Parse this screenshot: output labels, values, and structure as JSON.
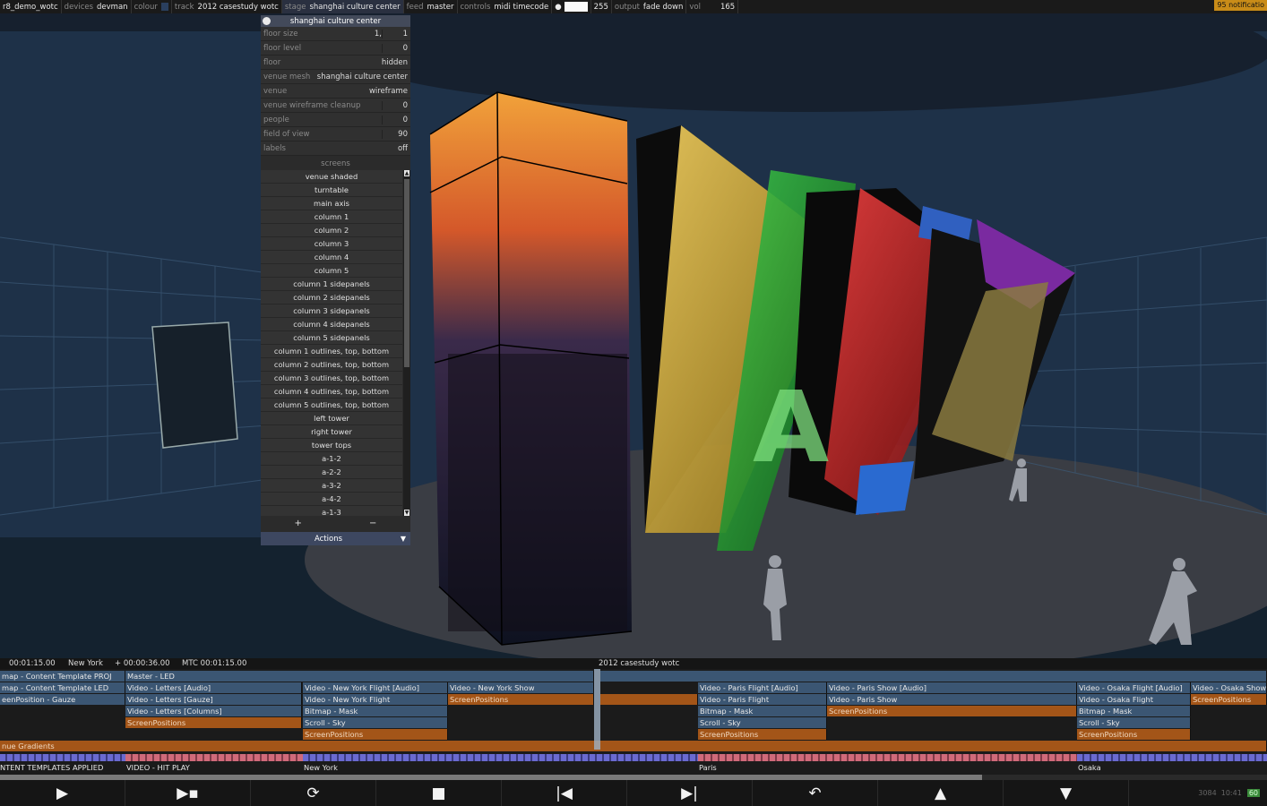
{
  "topbar": {
    "project": "r8_demo_wotc",
    "devices_label": "devices",
    "devices_value": "devman",
    "colour_label": "colour",
    "track_label": "track",
    "track_value": "2012 casestudy wotc",
    "stage_label": "stage",
    "stage_value": "shanghai culture center",
    "feed_label": "feed",
    "feed_value": "master",
    "controls_label": "controls",
    "controls_value": "midi timecode",
    "level_value": "255",
    "output_label": "output",
    "output_value": "fade down",
    "vol_label": "vol",
    "vol_value": "165",
    "notifications": "95 notificatio"
  },
  "panel": {
    "title": "shanghai culture center",
    "props": [
      {
        "label": "floor size",
        "value": "1,",
        "value2": "1"
      },
      {
        "label": "floor level",
        "value": "",
        "value2": "0"
      },
      {
        "label": "floor",
        "value": "hidden",
        "value2": ""
      },
      {
        "label": "venue mesh",
        "value": "shanghai culture center",
        "value2": ""
      },
      {
        "label": "venue",
        "value": "wireframe",
        "value2": ""
      },
      {
        "label": "venue wireframe cleanup",
        "value": "",
        "value2": "0"
      },
      {
        "label": "people",
        "value": "",
        "value2": "0"
      },
      {
        "label": "field of view",
        "value": "",
        "value2": "90"
      },
      {
        "label": "labels",
        "value": "off",
        "value2": ""
      }
    ],
    "screens_header": "screens",
    "screens": [
      "venue shaded",
      "turntable",
      "main axis",
      "column 1",
      "column 2",
      "column 3",
      "column 4",
      "column 5",
      "column 1 sidepanels",
      "column 2 sidepanels",
      "column 3 sidepanels",
      "column 4 sidepanels",
      "column 5 sidepanels",
      "column 1 outlines, top, bottom",
      "column 2 outlines, top, bottom",
      "column 3 outlines, top, bottom",
      "column 4 outlines, top, bottom",
      "column 5 outlines, top, bottom",
      "left tower",
      "right tower",
      "tower tops",
      "a-1-2",
      "a-2-2",
      "a-3-2",
      "a-4-2",
      "a-1-3"
    ],
    "plus": "+",
    "minus": "−",
    "actions": "Actions",
    "actions_arrow": "▼"
  },
  "timeline": {
    "time_left": "00:01:15.00",
    "location": "New York",
    "offset": "+ 00:00:36.00",
    "mtc": "MTC 00:01:15.00",
    "track_name": "2012 casestudy wotc",
    "rows": {
      "r0": [
        "map - Content Template PROJ",
        "Master - LED"
      ],
      "r1": [
        "map - Content Template LED",
        "Video - Letters [Audio]",
        "Video - New York Flight [Audio]",
        "Video - New York Show",
        "Video - Paris Flight [Audio]",
        "Video - Paris Show [Audio]",
        "Video - Osaka Flight [Audio]",
        "Video - Osaka Show"
      ],
      "r2": [
        "eenPosition - Gauze",
        "Video - Letters [Gauze]",
        "Video - New York Flight",
        "ScreenPositions",
        "Video - Paris Flight",
        "Video - Paris Show",
        "Video - Osaka Flight",
        "ScreenPositions"
      ],
      "r3": [
        "Video - Letters [Columns]",
        "Bitmap - Mask",
        "Bitmap - Mask",
        "ScreenPositions",
        "Bitmap - Mask"
      ],
      "r4": [
        "ScreenPositions",
        "Scroll - Sky",
        "Scroll - Sky",
        "Scroll - Sky"
      ],
      "r5": [
        "ScreenPositions",
        "ScreenPositions",
        "ScreenPositions"
      ],
      "r6": [
        "nue Gradients"
      ]
    },
    "markers": [
      "NTENT TEMPLATES APPLIED",
      "VIDEO - HIT PLAY",
      "New York",
      "Paris",
      "Osaka"
    ],
    "progress": 0.775
  },
  "transport": {
    "play": "▶",
    "play_step": "▶▪",
    "loop": "⟳",
    "stop": "■",
    "prev": "|◀",
    "next": "▶|",
    "undo": "↶",
    "up": "▲",
    "down": "▼",
    "clock_date": "3084",
    "clock_time": "10:41",
    "battery": "60"
  },
  "colors": {
    "clip_blue": "#3b5673",
    "clip_orange": "#a35518",
    "panel_bg": "#2b2b2b"
  }
}
